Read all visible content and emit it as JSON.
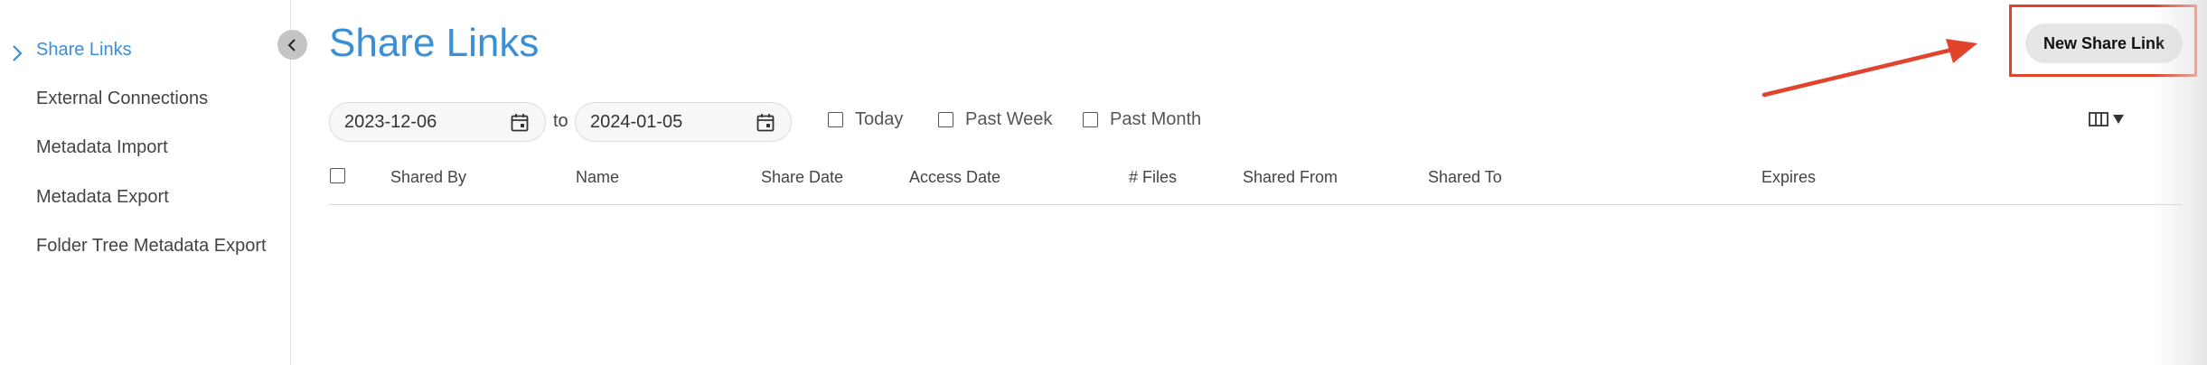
{
  "sidebar": {
    "items": [
      {
        "label": "Share Links",
        "active": true
      },
      {
        "label": "External Connections",
        "active": false
      },
      {
        "label": "Metadata Import",
        "active": false
      },
      {
        "label": "Metadata Export",
        "active": false
      },
      {
        "label": "Folder Tree Metadata Export",
        "active": false
      }
    ],
    "collapse_icon": "chevron-left-icon"
  },
  "page": {
    "title": "Share Links"
  },
  "toolbar": {
    "new_share_link_label": "New Share Link"
  },
  "filters": {
    "date_from": "2023-12-06",
    "date_to": "2024-01-05",
    "to_label": "to",
    "checkboxes": [
      {
        "label": "Today",
        "checked": false
      },
      {
        "label": "Past Week",
        "checked": false
      },
      {
        "label": "Past Month",
        "checked": false
      }
    ],
    "columns_toggle_icon": "columns-icon"
  },
  "table": {
    "columns": [
      "Shared By",
      "Name",
      "Share Date",
      "Access Date",
      "# Files",
      "Shared From",
      "Shared To",
      "Expires"
    ],
    "rows": []
  },
  "colors": {
    "accent": "#3a8fd6",
    "annotation": "#e0442c",
    "button_bg": "#e6e6e6"
  }
}
